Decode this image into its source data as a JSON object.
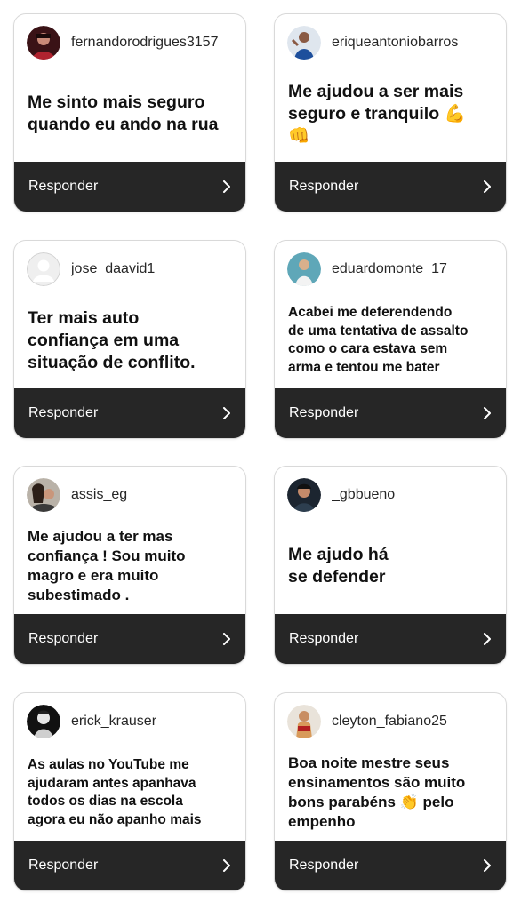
{
  "reply_label": "Responder",
  "colors": {
    "footer": "#262626",
    "border": "#d9d9d9"
  },
  "cards": [
    {
      "username": "fernandorodrigues3157",
      "text": "Me sinto mais seguro\nquando eu ando na rua",
      "size": "l",
      "avatar": "dark-red"
    },
    {
      "username": "eriqueantoniobarros",
      "text": "Me ajudou a ser mais\nseguro e tranquilo 💪\n👊",
      "size": "l",
      "avatar": "blue-person"
    },
    {
      "username": "jose_daavid1",
      "text": "Ter mais auto\nconfiança em uma\nsituação de conflito.",
      "size": "l",
      "avatar": "default"
    },
    {
      "username": "eduardomonte_17",
      "text": "Acabei me deferendendo\nde uma tentativa de assalto\ncomo o cara estava sem\narma e tentou me bater",
      "size": "s",
      "avatar": "teal-person"
    },
    {
      "username": "assis_eg",
      "text": "Me ajudou a ter mas\nconfiança ! Sou muito\nmagro e era muito\nsubestimado .",
      "size": "m",
      "avatar": "couple"
    },
    {
      "username": "_gbbueno",
      "text": "Me ajudo há\nse defender",
      "size": "l",
      "avatar": "dark-person"
    },
    {
      "username": "erick_krauser",
      "text": "As aulas no YouTube me\najudaram antes apanhava\ntodos os dias na escola\nagora eu não apanho mais",
      "size": "s",
      "avatar": "bw-person"
    },
    {
      "username": "cleyton_fabiano25",
      "text": "Boa noite mestre seus\nensinamentos são muito\nbons parabéns 👏 pelo\nempenho",
      "size": "m",
      "avatar": "fighter"
    }
  ]
}
